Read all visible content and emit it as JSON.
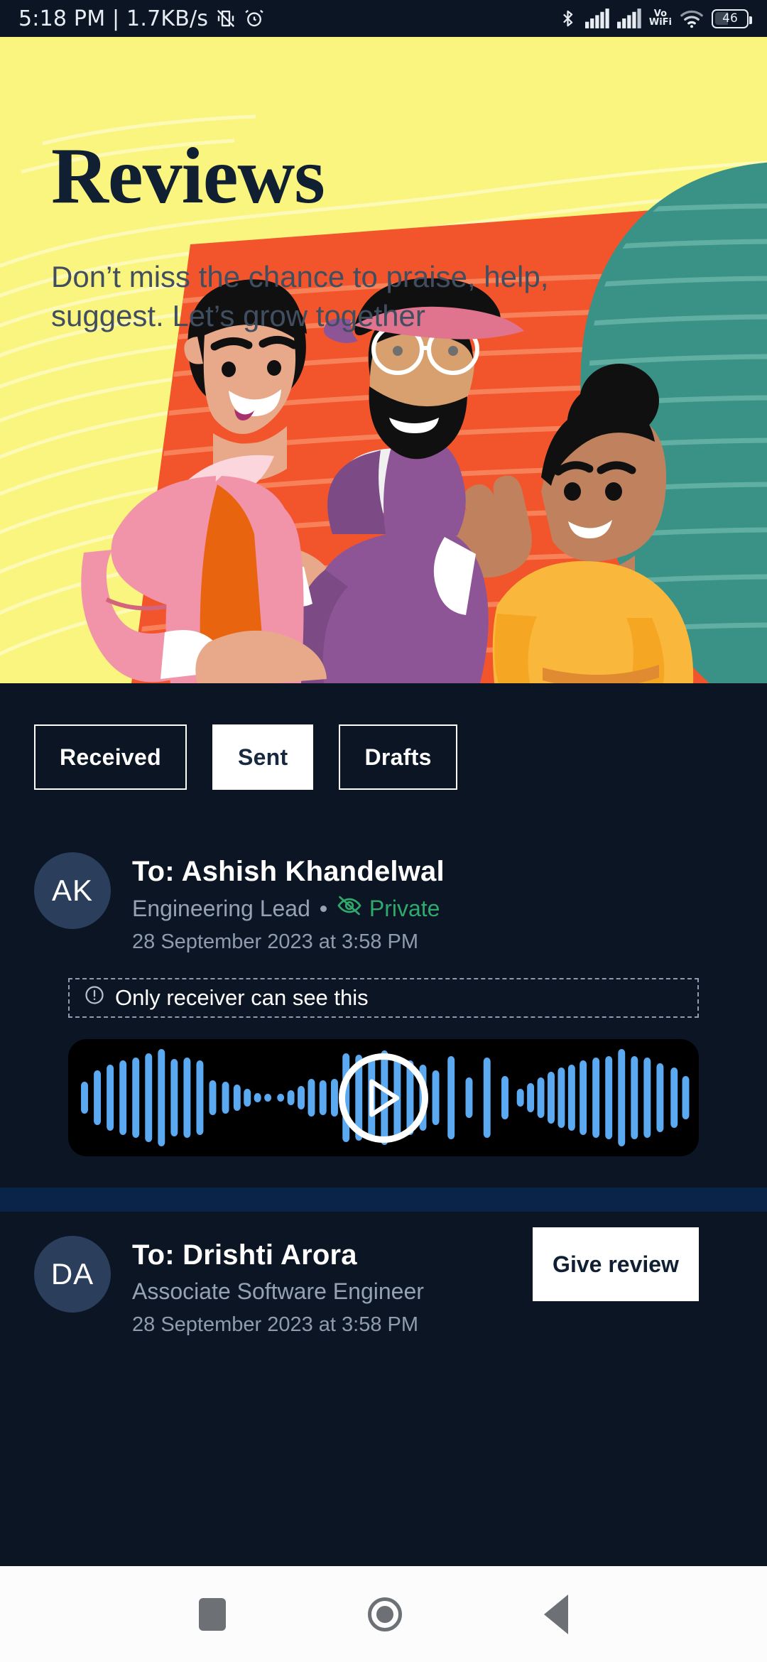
{
  "statusbar": {
    "time_text": "5:18 PM | 1.7KB/s",
    "battery_level": "46",
    "vo_label": "Vo",
    "wifi_label": "WiFi",
    "icons": [
      "vibrate-off-icon",
      "alarm-icon",
      "bluetooth-icon",
      "signal-icon",
      "signal-icon",
      "vowifi-icon",
      "wifi-icon",
      "battery-icon"
    ]
  },
  "hero": {
    "title": "Reviews",
    "subtitle": "Don’t miss the chance to praise, help, suggest. Let’s grow together",
    "bg_color": "#faf57e",
    "orange": "#f2552c",
    "teal": "#3a9287"
  },
  "tabs": [
    {
      "label": "Received",
      "active": false
    },
    {
      "label": "Sent",
      "active": true
    },
    {
      "label": "Drafts",
      "active": false
    }
  ],
  "reviews": [
    {
      "initials": "AK",
      "to_name": "To: Ashish Khandelwal",
      "role": "Engineering Lead",
      "visibility": "Private",
      "timestamp": "28 September 2023 at 3:58 PM",
      "notice": "Only receiver can see this"
    },
    {
      "initials": "DA",
      "to_name": "To: Drishti Arora",
      "role": "Associate Software Engineer",
      "timestamp": "28 September 2023 at 3:58 PM",
      "action_label": "Give review"
    }
  ],
  "colors": {
    "background": "#0b1524",
    "private_green": "#2fa96c",
    "waveform_blue": "#5ba9f0",
    "avatar_bg": "#2b3e5c",
    "separator_band": "#0a2348"
  },
  "navbar": {
    "recents": "recents-square",
    "home": "home-circle",
    "back": "back-triangle"
  }
}
